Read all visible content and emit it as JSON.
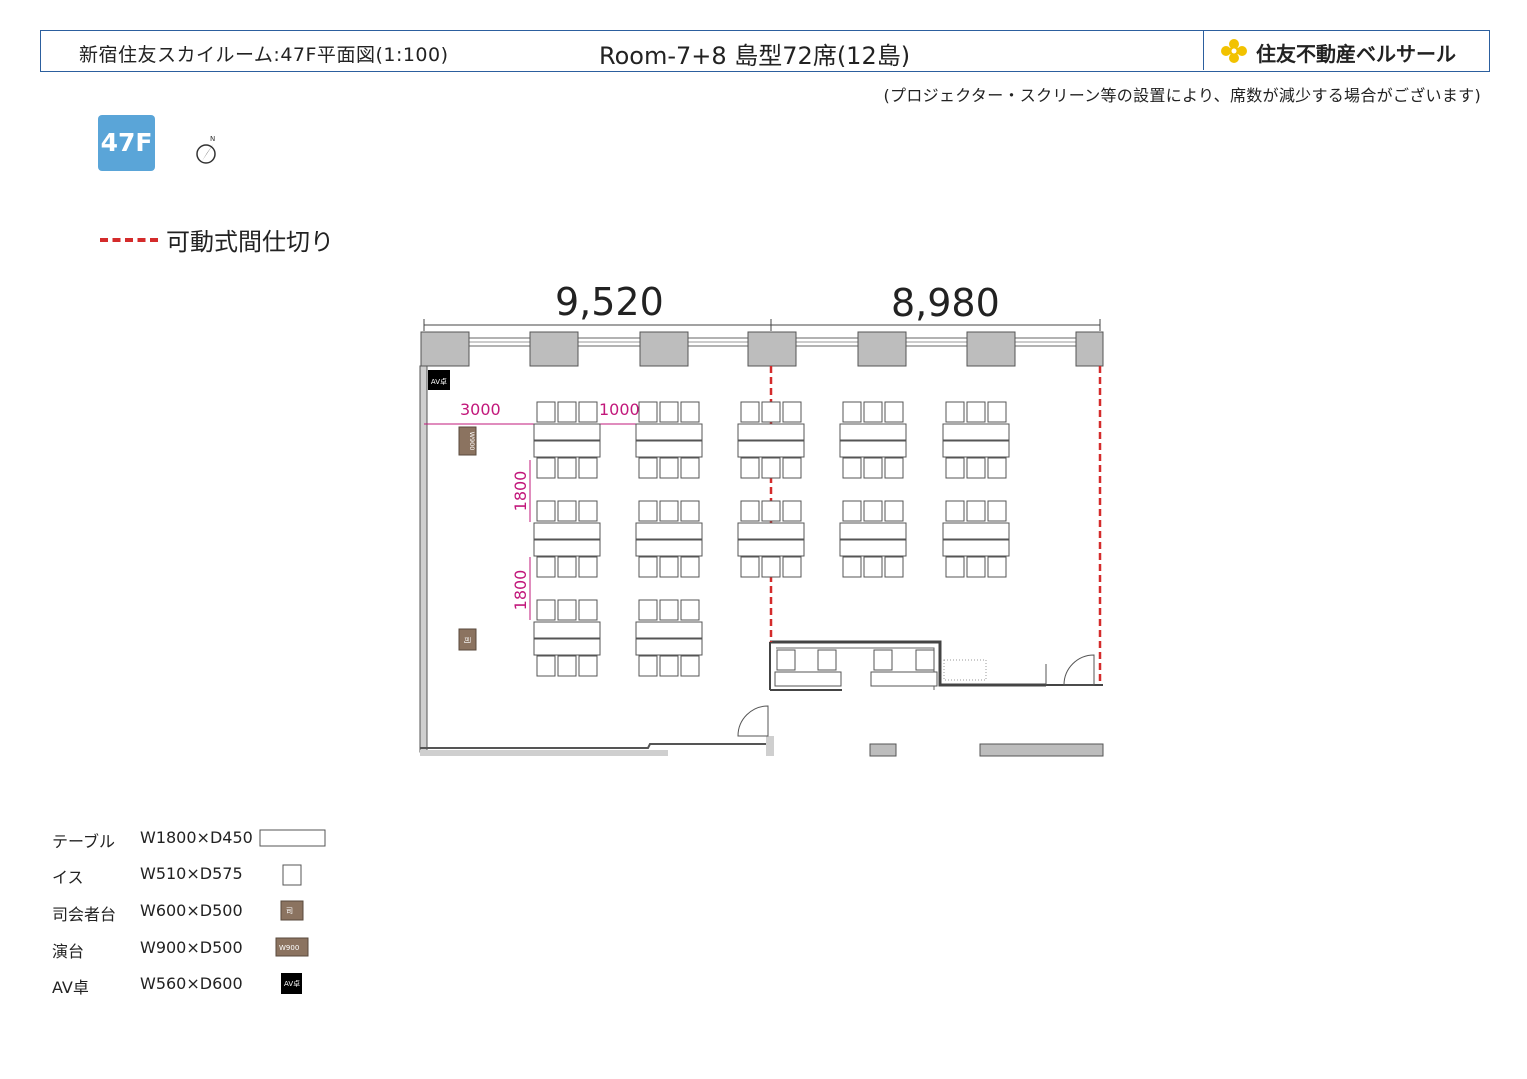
{
  "header": {
    "venue_title": "新宿住友スカイルーム:47F平面図(1:100)",
    "room_title": "Room-7+8 島型72席(12島)",
    "brand": "住友不動産ベルサール"
  },
  "note": "(プロジェクター・スクリーン等の設置により、席数が減少する場合がございます)",
  "floor_badge": "47F",
  "compass_label": "N",
  "partition_legend": "可動式間仕切り",
  "plan": {
    "dim_left": "9,520",
    "dim_right": "8,980",
    "spacing_3000": "3000",
    "spacing_1000": "1000",
    "row_gap_1": "1800",
    "row_gap_2": "1800",
    "av_label": "AV卓",
    "lectern_label": "W900",
    "mc_label": "司",
    "islands": 12,
    "seats": 72
  },
  "legend": [
    {
      "label": "テーブル",
      "size": "W1800×D450"
    },
    {
      "label": "イス",
      "size": "W510×D575"
    },
    {
      "label": "司会者台",
      "size": "W600×D500",
      "mark": "司"
    },
    {
      "label": "演台",
      "size": "W900×D500",
      "mark": "W900"
    },
    {
      "label": "AV卓",
      "size": "W560×D600",
      "mark": "AV卓"
    }
  ],
  "colors": {
    "partition": "#d42b2b",
    "dimension_magenta": "#c2187b",
    "floor_badge": "#5aa5d8",
    "furniture_brown": "#8b7360",
    "header_border": "#2c5f9e",
    "brand_yellow": "#f2c200"
  }
}
